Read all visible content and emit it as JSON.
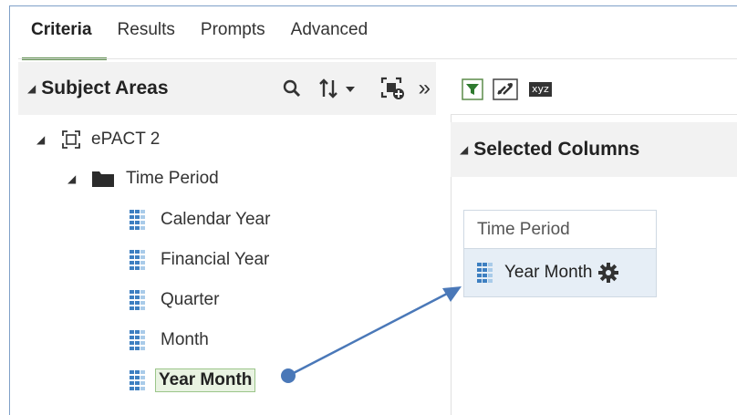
{
  "tabs": [
    {
      "label": "Criteria",
      "active": true
    },
    {
      "label": "Results"
    },
    {
      "label": "Prompts"
    },
    {
      "label": "Advanced"
    }
  ],
  "subject_areas": {
    "title": "Subject Areas",
    "icons": [
      "search-icon",
      "sort-icon",
      "new-column-icon",
      "expand-panel-icon"
    ]
  },
  "tree": {
    "root": "ePACT 2",
    "folder": "Time Period",
    "columns": [
      "Calendar Year",
      "Financial Year",
      "Quarter",
      "Month",
      "Year Month"
    ],
    "selected": "Year Month"
  },
  "toolbar": {
    "icons": [
      "filter-icon",
      "edit-formula-icon",
      "xyz-icon"
    ],
    "xyz_label": "xyz"
  },
  "selected_columns": {
    "title": "Selected Columns",
    "group": "Time Period",
    "item": "Year Month",
    "item_icon": "gear-icon"
  },
  "colors": {
    "accent_green": "#5b8c4a",
    "arrow_blue": "#4a78b8",
    "column_icon_blue": "#3d7fc1"
  }
}
